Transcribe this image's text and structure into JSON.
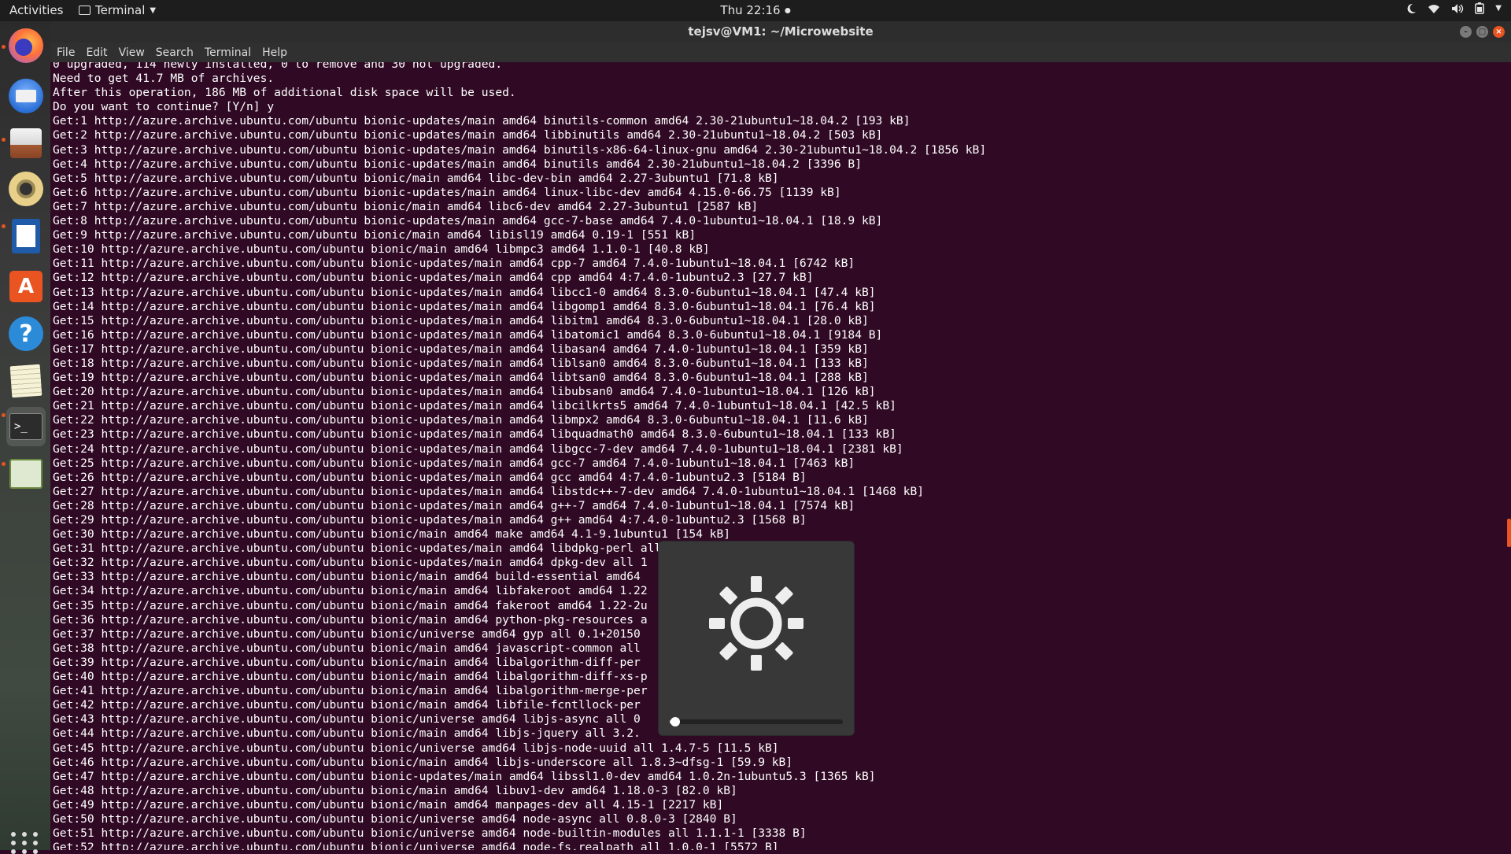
{
  "topbar": {
    "activities": "Activities",
    "app_menu": "Terminal",
    "clock": "Thu 22:16"
  },
  "dock": {
    "items": [
      "Firefox",
      "Thunderbird",
      "Files",
      "Rhythmbox",
      "LibreOffice Writer",
      "Ubuntu Software",
      "Help",
      "Text Editor",
      "Terminal",
      "System Monitor"
    ]
  },
  "window": {
    "title": "tejsv@VM1: ~/Microwebsite",
    "menu": [
      "File",
      "Edit",
      "View",
      "Search",
      "Terminal",
      "Help"
    ]
  },
  "osd": {
    "type": "brightness",
    "level_percent": 3
  },
  "terminal": {
    "lines": [
      "0 upgraded, 114 newly installed, 0 to remove and 30 not upgraded.",
      "Need to get 41.7 MB of archives.",
      "After this operation, 186 MB of additional disk space will be used.",
      "Do you want to continue? [Y/n] y",
      "Get:1 http://azure.archive.ubuntu.com/ubuntu bionic-updates/main amd64 binutils-common amd64 2.30-21ubuntu1~18.04.2 [193 kB]",
      "Get:2 http://azure.archive.ubuntu.com/ubuntu bionic-updates/main amd64 libbinutils amd64 2.30-21ubuntu1~18.04.2 [503 kB]",
      "Get:3 http://azure.archive.ubuntu.com/ubuntu bionic-updates/main amd64 binutils-x86-64-linux-gnu amd64 2.30-21ubuntu1~18.04.2 [1856 kB]",
      "Get:4 http://azure.archive.ubuntu.com/ubuntu bionic-updates/main amd64 binutils amd64 2.30-21ubuntu1~18.04.2 [3396 B]",
      "Get:5 http://azure.archive.ubuntu.com/ubuntu bionic/main amd64 libc-dev-bin amd64 2.27-3ubuntu1 [71.8 kB]",
      "Get:6 http://azure.archive.ubuntu.com/ubuntu bionic-updates/main amd64 linux-libc-dev amd64 4.15.0-66.75 [1139 kB]",
      "Get:7 http://azure.archive.ubuntu.com/ubuntu bionic/main amd64 libc6-dev amd64 2.27-3ubuntu1 [2587 kB]",
      "Get:8 http://azure.archive.ubuntu.com/ubuntu bionic-updates/main amd64 gcc-7-base amd64 7.4.0-1ubuntu1~18.04.1 [18.9 kB]",
      "Get:9 http://azure.archive.ubuntu.com/ubuntu bionic/main amd64 libisl19 amd64 0.19-1 [551 kB]",
      "Get:10 http://azure.archive.ubuntu.com/ubuntu bionic/main amd64 libmpc3 amd64 1.1.0-1 [40.8 kB]",
      "Get:11 http://azure.archive.ubuntu.com/ubuntu bionic-updates/main amd64 cpp-7 amd64 7.4.0-1ubuntu1~18.04.1 [6742 kB]",
      "Get:12 http://azure.archive.ubuntu.com/ubuntu bionic-updates/main amd64 cpp amd64 4:7.4.0-1ubuntu2.3 [27.7 kB]",
      "Get:13 http://azure.archive.ubuntu.com/ubuntu bionic-updates/main amd64 libcc1-0 amd64 8.3.0-6ubuntu1~18.04.1 [47.4 kB]",
      "Get:14 http://azure.archive.ubuntu.com/ubuntu bionic-updates/main amd64 libgomp1 amd64 8.3.0-6ubuntu1~18.04.1 [76.4 kB]",
      "Get:15 http://azure.archive.ubuntu.com/ubuntu bionic-updates/main amd64 libitm1 amd64 8.3.0-6ubuntu1~18.04.1 [28.0 kB]",
      "Get:16 http://azure.archive.ubuntu.com/ubuntu bionic-updates/main amd64 libatomic1 amd64 8.3.0-6ubuntu1~18.04.1 [9184 B]",
      "Get:17 http://azure.archive.ubuntu.com/ubuntu bionic-updates/main amd64 libasan4 amd64 7.4.0-1ubuntu1~18.04.1 [359 kB]",
      "Get:18 http://azure.archive.ubuntu.com/ubuntu bionic-updates/main amd64 liblsan0 amd64 8.3.0-6ubuntu1~18.04.1 [133 kB]",
      "Get:19 http://azure.archive.ubuntu.com/ubuntu bionic-updates/main amd64 libtsan0 amd64 8.3.0-6ubuntu1~18.04.1 [288 kB]",
      "Get:20 http://azure.archive.ubuntu.com/ubuntu bionic-updates/main amd64 libubsan0 amd64 7.4.0-1ubuntu1~18.04.1 [126 kB]",
      "Get:21 http://azure.archive.ubuntu.com/ubuntu bionic-updates/main amd64 libcilkrts5 amd64 7.4.0-1ubuntu1~18.04.1 [42.5 kB]",
      "Get:22 http://azure.archive.ubuntu.com/ubuntu bionic-updates/main amd64 libmpx2 amd64 8.3.0-6ubuntu1~18.04.1 [11.6 kB]",
      "Get:23 http://azure.archive.ubuntu.com/ubuntu bionic-updates/main amd64 libquadmath0 amd64 8.3.0-6ubuntu1~18.04.1 [133 kB]",
      "Get:24 http://azure.archive.ubuntu.com/ubuntu bionic-updates/main amd64 libgcc-7-dev amd64 7.4.0-1ubuntu1~18.04.1 [2381 kB]",
      "Get:25 http://azure.archive.ubuntu.com/ubuntu bionic-updates/main amd64 gcc-7 amd64 7.4.0-1ubuntu1~18.04.1 [7463 kB]",
      "Get:26 http://azure.archive.ubuntu.com/ubuntu bionic-updates/main amd64 gcc amd64 4:7.4.0-1ubuntu2.3 [5184 B]",
      "Get:27 http://azure.archive.ubuntu.com/ubuntu bionic-updates/main amd64 libstdc++-7-dev amd64 7.4.0-1ubuntu1~18.04.1 [1468 kB]",
      "Get:28 http://azure.archive.ubuntu.com/ubuntu bionic-updates/main amd64 g++-7 amd64 7.4.0-1ubuntu1~18.04.1 [7574 kB]",
      "Get:29 http://azure.archive.ubuntu.com/ubuntu bionic-updates/main amd64 g++ amd64 4:7.4.0-1ubuntu2.3 [1568 B]",
      "Get:30 http://azure.archive.ubuntu.com/ubuntu bionic/main amd64 make amd64 4.1-9.1ubuntu1 [154 kB]",
      "Get:31 http://azure.archive.ubuntu.com/ubuntu bionic-updates/main amd64 libdpkg-perl all                       kB]",
      "Get:32 http://azure.archive.ubuntu.com/ubuntu bionic-updates/main amd64 dpkg-dev all 1",
      "Get:33 http://azure.archive.ubuntu.com/ubuntu bionic/main amd64 build-essential amd64",
      "Get:34 http://azure.archive.ubuntu.com/ubuntu bionic/main amd64 libfakeroot amd64 1.22",
      "Get:35 http://azure.archive.ubuntu.com/ubuntu bionic/main amd64 fakeroot amd64 1.22-2u",
      "Get:36 http://azure.archive.ubuntu.com/ubuntu bionic/main amd64 python-pkg-resources a",
      "Get:37 http://azure.archive.ubuntu.com/ubuntu bionic/universe amd64 gyp all 0.1+20150                          kB]",
      "Get:38 http://azure.archive.ubuntu.com/ubuntu bionic/main amd64 javascript-common all",
      "Get:39 http://azure.archive.ubuntu.com/ubuntu bionic/main amd64 libalgorithm-diff-per",
      "Get:40 http://azure.archive.ubuntu.com/ubuntu bionic/main amd64 libalgorithm-diff-xs-p",
      "Get:41 http://azure.archive.ubuntu.com/ubuntu bionic/main amd64 libalgorithm-merge-per",
      "Get:42 http://azure.archive.ubuntu.com/ubuntu bionic/main amd64 libfile-fcntllock-per                          B]",
      "Get:43 http://azure.archive.ubuntu.com/ubuntu bionic/universe amd64 libjs-async all 0",
      "Get:44 http://azure.archive.ubuntu.com/ubuntu bionic/main amd64 libjs-jquery all 3.2.",
      "Get:45 http://azure.archive.ubuntu.com/ubuntu bionic/universe amd64 libjs-node-uuid all 1.4.7-5 [11.5 kB]",
      "Get:46 http://azure.archive.ubuntu.com/ubuntu bionic/main amd64 libjs-underscore all 1.8.3~dfsg-1 [59.9 kB]",
      "Get:47 http://azure.archive.ubuntu.com/ubuntu bionic-updates/main amd64 libssl1.0-dev amd64 1.0.2n-1ubuntu5.3 [1365 kB]",
      "Get:48 http://azure.archive.ubuntu.com/ubuntu bionic/main amd64 libuv1-dev amd64 1.18.0-3 [82.0 kB]",
      "Get:49 http://azure.archive.ubuntu.com/ubuntu bionic/main amd64 manpages-dev all 4.15-1 [2217 kB]",
      "Get:50 http://azure.archive.ubuntu.com/ubuntu bionic/universe amd64 node-async all 0.8.0-3 [2840 B]",
      "Get:51 http://azure.archive.ubuntu.com/ubuntu bionic/universe amd64 node-builtin-modules all 1.1.1-1 [3338 B]",
      "Get:52 http://azure.archive.ubuntu.com/ubuntu bionic/universe amd64 node-fs.realpath all 1.0.0-1 [5572 B]"
    ]
  }
}
